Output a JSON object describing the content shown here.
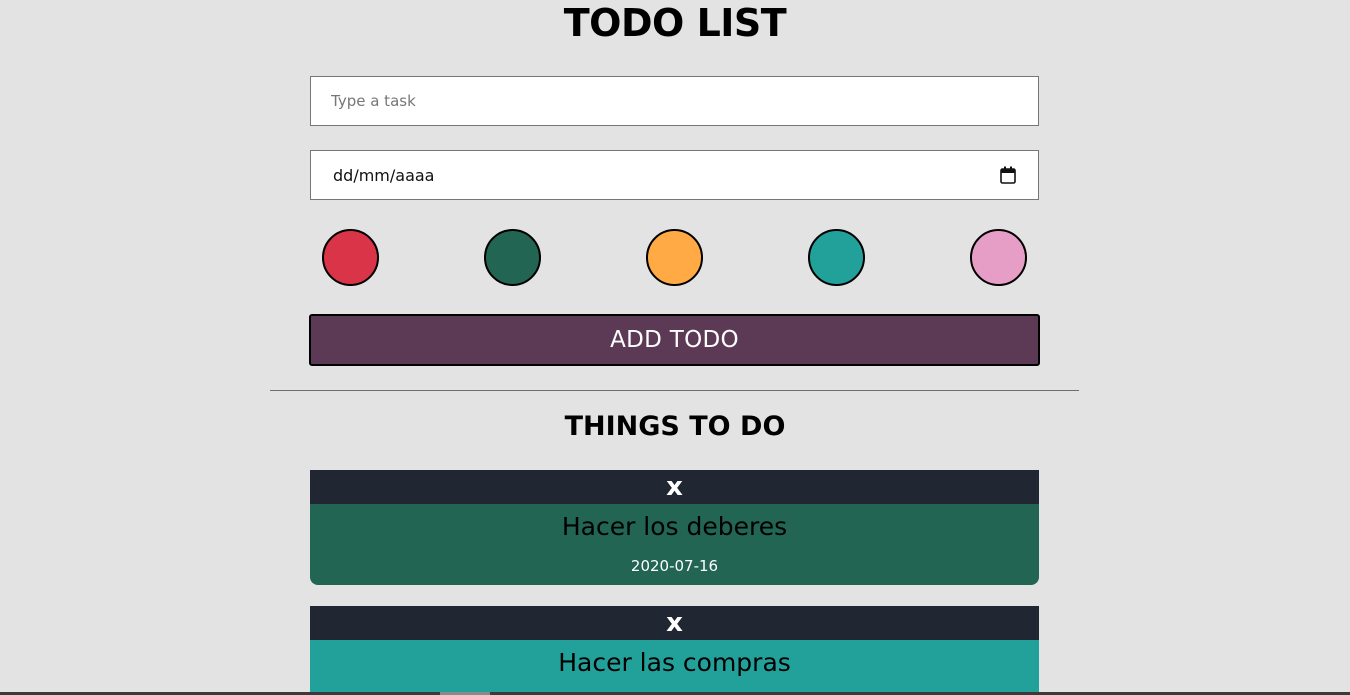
{
  "app": {
    "title": "TODO LIST"
  },
  "form": {
    "task_placeholder": "Type a task",
    "task_value": "",
    "date_placeholder": "dd/mm/aaaa",
    "add_button_label": "ADD TODO"
  },
  "colors": {
    "background": "#e3e3e3",
    "button": "#5c3a55",
    "card_header": "#202632",
    "swatches": [
      "#d93448",
      "#216552",
      "#ffaa44",
      "#22a19b",
      "#e79ec6"
    ]
  },
  "list": {
    "title": "THINGS TO DO",
    "delete_label": "x",
    "items": [
      {
        "text": "Hacer los deberes",
        "date": "2020-07-16",
        "color": "#216552"
      },
      {
        "text": "Hacer las compras",
        "date": "",
        "color": "#22a19b"
      }
    ]
  }
}
